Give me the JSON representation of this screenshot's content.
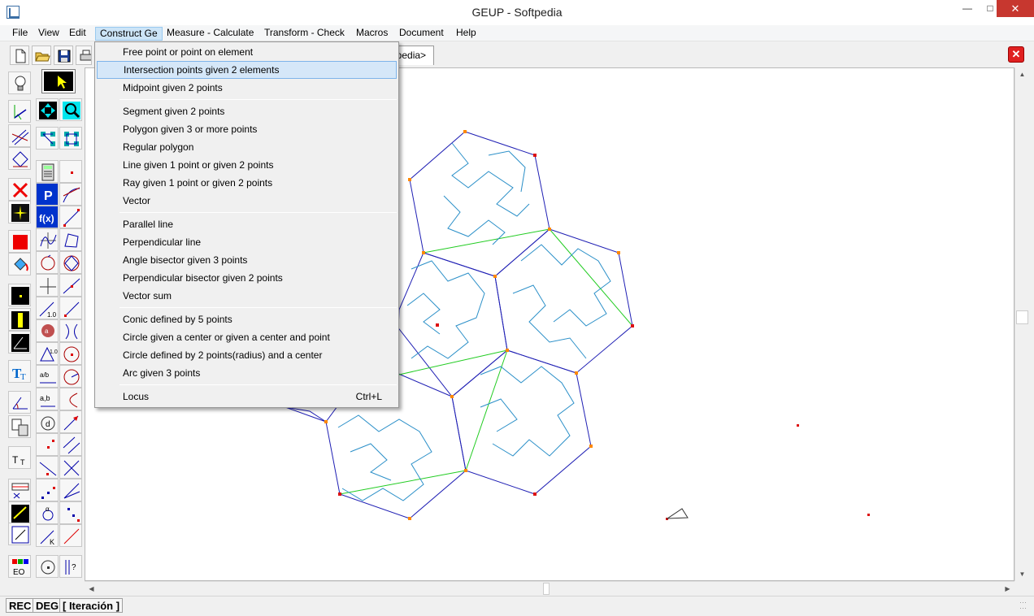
{
  "window": {
    "title": "GEUP - Softpedia",
    "minimize_icon": "minimize-icon",
    "maximize_icon": "maximize-icon",
    "close_icon": "close-icon"
  },
  "menubar": {
    "items": [
      "File",
      "View",
      "Edit",
      "Construct Ge",
      "Measure - Calculate",
      "Transform - Check",
      "Macros",
      "Document",
      "Help"
    ],
    "active": "Construct Ge"
  },
  "toolbar": {
    "icons": [
      "new-document-icon",
      "open-folder-icon",
      "save-icon",
      "print-icon"
    ],
    "document_tab": "ftpedia>",
    "close_document_icon": "close-document-icon"
  },
  "construct_menu": {
    "groups": [
      [
        "Free point or point on element",
        "Intersection points given 2 elements",
        "Midpoint given 2 points"
      ],
      [
        "Segment given 2 points",
        "Polygon given 3 or more points",
        "Regular polygon",
        "Line given 1 point or given 2 points",
        "Ray given 1 point or given 2 points",
        "Vector"
      ],
      [
        "Parallel line",
        "Perpendicular line",
        "Angle bisector given 3 points",
        "Perpendicular bisector given 2 points",
        "Vector sum"
      ],
      [
        "Conic defined by 5 points",
        "Circle given a center or given a center and point",
        "Circle defined by 2 points(radius) and a center",
        "Arc given 3 points"
      ],
      [
        "Locus"
      ]
    ],
    "highlighted": "Intersection points given 2 elements",
    "shortcuts": {
      "Locus": "Ctrl+L"
    }
  },
  "statusbar": {
    "mode": "REC",
    "angle_unit": "DEG",
    "state": "[ Iteración ]"
  },
  "colors": {
    "hexagon_edge": "#1f1fb4",
    "curve": "#2a8fc8",
    "green_line": "#22cc22",
    "orange_vertex": "#ff8800",
    "red_vertex": "#dd1111",
    "menu_highlight": "#d5e7f8",
    "close_red": "#c7372f"
  }
}
